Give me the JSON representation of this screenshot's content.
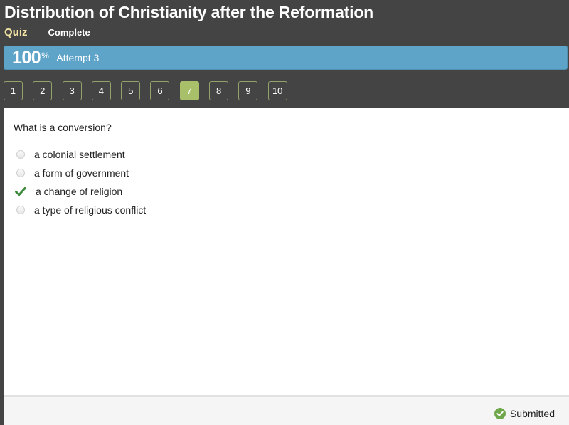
{
  "header": {
    "title": "Distribution of Christianity after the Reformation",
    "quiz_label": "Quiz",
    "status": "Complete"
  },
  "score": {
    "value": "100",
    "unit": "%",
    "attempt": "Attempt 3",
    "color": "#5ea3c8"
  },
  "question_nav": {
    "items": [
      "1",
      "2",
      "3",
      "4",
      "5",
      "6",
      "7",
      "8",
      "9",
      "10"
    ],
    "active": "7",
    "active_color": "#a9c06a"
  },
  "question": {
    "text": "What is a conversion?",
    "options": [
      {
        "label": "a colonial settlement",
        "state": "unselected",
        "icon": "radio-icon"
      },
      {
        "label": "a form of government",
        "state": "unselected",
        "icon": "radio-icon"
      },
      {
        "label": "a change of religion",
        "state": "correct",
        "icon": "checkmark-icon"
      },
      {
        "label": "a type of religious conflict",
        "state": "unselected",
        "icon": "radio-icon"
      }
    ]
  },
  "footer": {
    "status": "Submitted",
    "icon": "check-circle-icon"
  }
}
